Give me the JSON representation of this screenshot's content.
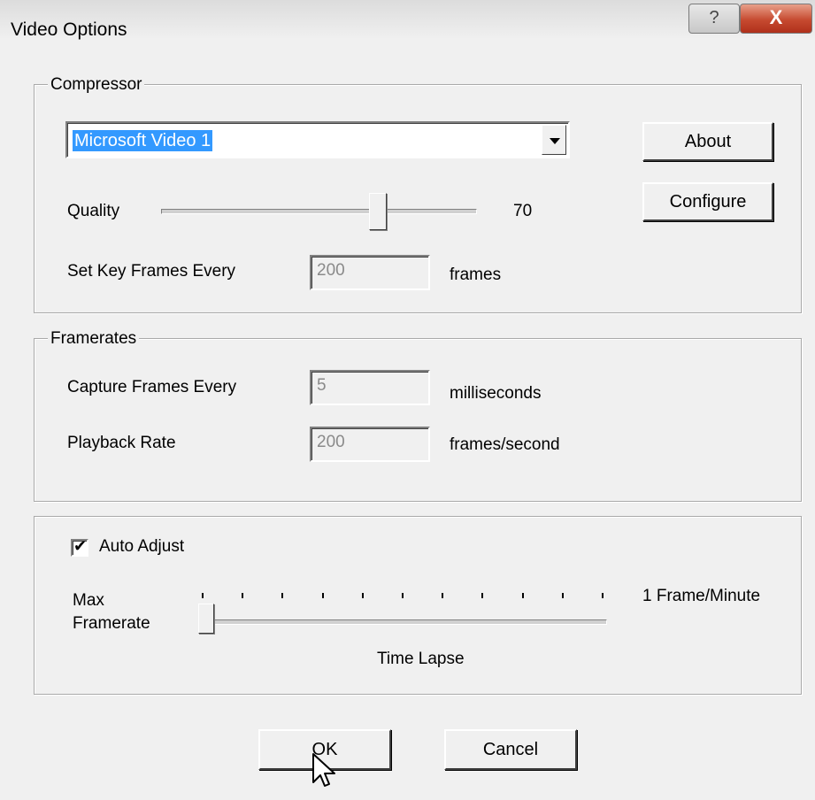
{
  "window": {
    "title": "Video Options",
    "help_symbol": "?",
    "close_symbol": "X"
  },
  "compressor": {
    "group_label": "Compressor",
    "codec_selected": "Microsoft Video 1",
    "about_label": "About",
    "configure_label": "Configure",
    "quality_label": "Quality",
    "quality_value": "70",
    "quality_fraction": 0.7,
    "keyframe_label": "Set Key Frames Every",
    "keyframe_value": "200",
    "keyframe_unit": "frames"
  },
  "framerates": {
    "group_label": "Framerates",
    "capture_label": "Capture Frames Every",
    "capture_value": "5",
    "capture_unit": "milliseconds",
    "playback_label": "Playback Rate",
    "playback_value": "200",
    "playback_unit": "frames/second"
  },
  "timelapse": {
    "auto_adjust_label": "Auto Adjust",
    "auto_adjust_checked": true,
    "max_label_line1": "Max",
    "max_label_line2": "Framerate",
    "min_label": "1 Frame/Minute",
    "slider_caption": "Time Lapse",
    "slider_position": 0
  },
  "buttons": {
    "ok_label": "OK",
    "cancel_label": "Cancel"
  }
}
